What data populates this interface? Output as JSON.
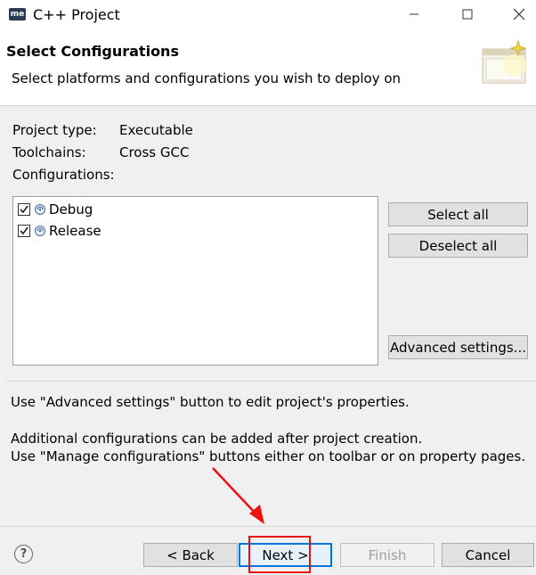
{
  "window": {
    "logo_text": "me",
    "title": "C++ Project",
    "buttons": [
      "minimize-icon",
      "maximize-icon",
      "close-icon"
    ]
  },
  "header": {
    "title": "Select Configurations",
    "description": "Select platforms and configurations you wish to deploy on",
    "icon": "wizard-banner-icon"
  },
  "info": {
    "project_type_label": "Project type:",
    "project_type_value": "Executable",
    "toolchains_label": "Toolchains:",
    "toolchains_value": "Cross GCC",
    "configurations_label": "Configurations:"
  },
  "configurations": [
    {
      "label": "Debug",
      "checked": true
    },
    {
      "label": "Release",
      "checked": true
    }
  ],
  "side_buttons": {
    "select_all": "Select all",
    "deselect_all": "Deselect all",
    "advanced": "Advanced settings..."
  },
  "descriptions": [
    "Use \"Advanced settings\" button to edit project's properties.",
    "Additional configurations can be added after project creation.",
    "Use \"Manage configurations\" buttons either on toolbar or on property pages."
  ],
  "footer": {
    "help_icon": "?",
    "back": "< Back",
    "next": "Next >",
    "finish": "Finish",
    "cancel": "Cancel"
  },
  "colors": {
    "annotation": "#ee1111",
    "default_button_border": "#0078d7"
  }
}
